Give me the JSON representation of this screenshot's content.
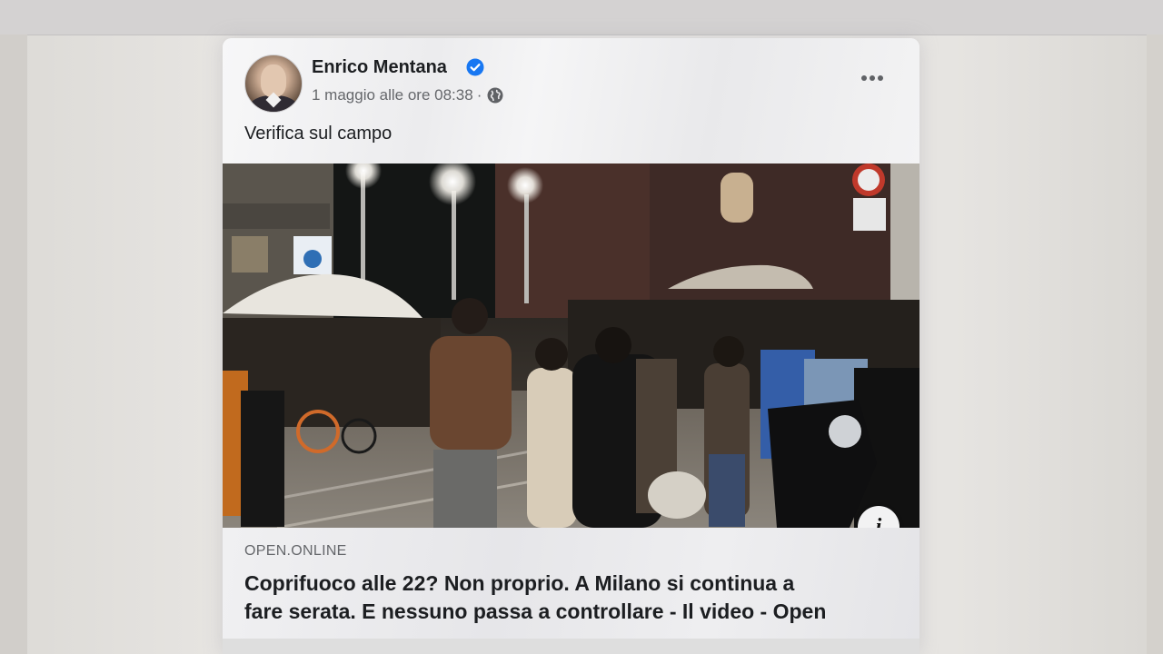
{
  "post": {
    "author_name": "Enrico Mentana",
    "timestamp": "1 maggio alle ore 08:38",
    "separator": "·",
    "text": "Verifica sul campo",
    "verified_icon": "verified-badge-icon",
    "audience_icon": "globe-icon",
    "more_icon": "more-options-icon"
  },
  "link_preview": {
    "domain": "OPEN.ONLINE",
    "headline_line1": "Coprifuoco alle 22? Non proprio. A Milano si continua a",
    "headline_line2": "fare serata. E nessuno passa a controllare - Il video - Open",
    "info_label": "i"
  },
  "colors": {
    "verified_blue": "#1877f2",
    "text_primary": "#1c1e21",
    "text_secondary": "#65676b"
  }
}
